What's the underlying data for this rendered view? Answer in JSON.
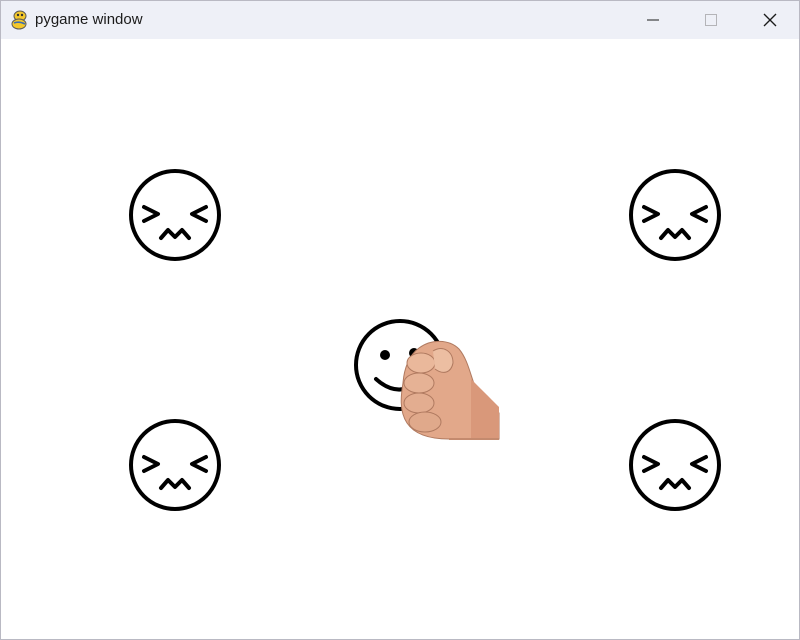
{
  "window": {
    "title": "pygame window",
    "app_icon": "pygame-snake-icon",
    "controls": [
      "minimize-icon",
      "maximize-icon",
      "close-icon"
    ]
  },
  "game": {
    "enemies": [
      {
        "icon": "angry-face-icon",
        "expression": "squinting-zigzag-mouth"
      },
      {
        "icon": "angry-face-icon",
        "expression": "squinting-zigzag-mouth"
      },
      {
        "icon": "angry-face-icon",
        "expression": "squinting-zigzag-mouth"
      },
      {
        "icon": "angry-face-icon",
        "expression": "squinting-zigzag-mouth"
      }
    ],
    "player": {
      "icon": "smiley-face-icon"
    },
    "cursor": {
      "icon": "fist-hand-icon"
    },
    "colors": {
      "background": "#ffffff",
      "outline": "#000000",
      "titlebar": "#eef0f7",
      "skin": "#e2a88a"
    }
  }
}
